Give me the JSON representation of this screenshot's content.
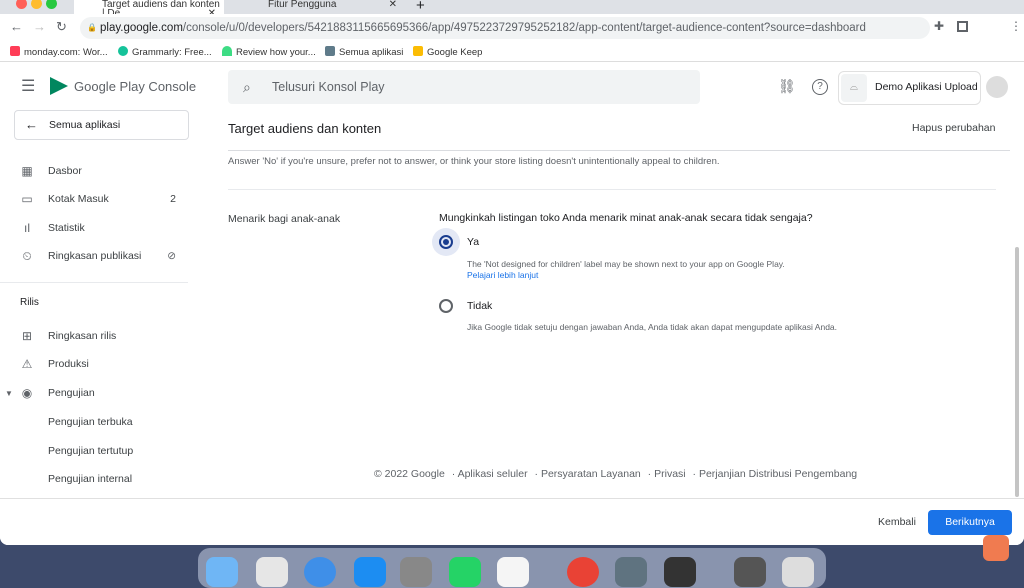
{
  "browser": {
    "tabs": [
      {
        "title": "Target audiens dan konten | De"
      },
      {
        "title": "Fitur Pengguna"
      }
    ],
    "url_host": "play.google.com",
    "url_path": "/console/u/0/developers/5421883115665695366/app/4975223729795252182/app-content/target-audience-content?source=dashboard",
    "bookmarks": [
      {
        "label": "monday.com: Wor...",
        "color": "#ff3d57"
      },
      {
        "label": "Grammarly: Free...",
        "color": "#15c39a"
      },
      {
        "label": "Review how your...",
        "color": "#3ddc84"
      },
      {
        "label": "Semua aplikasi",
        "color": "#5f7b8a"
      },
      {
        "label": "Google Keep",
        "color": "#fbbc04"
      }
    ]
  },
  "header": {
    "logo": "Google Play Console",
    "search_placeholder": "Telusuri Konsol Play",
    "app_name": "Demo Aplikasi Upload"
  },
  "sidebar": {
    "all_apps": "Semua aplikasi",
    "items": [
      {
        "label": "Dasbor",
        "icon": "dashboard-icon"
      },
      {
        "label": "Kotak Masuk",
        "badge": "2",
        "icon": "inbox-icon"
      },
      {
        "label": "Statistik",
        "icon": "bar-chart-icon"
      },
      {
        "label": "Ringkasan publikasi",
        "icon": "publishing-icon"
      }
    ],
    "section": "Rilis",
    "release_items": [
      {
        "label": "Ringkasan rilis"
      },
      {
        "label": "Produksi"
      },
      {
        "label": "Pengujian"
      }
    ],
    "testing_items": [
      "Pengujian terbuka",
      "Pengujian tertutup",
      "Pengujian internal"
    ]
  },
  "page": {
    "title": "Target audiens dan konten",
    "discard": "Hapus perubahan",
    "note": "Answer 'No' if you're unsure, prefer not to answer, or think your store listing doesn't unintentionally appeal to children.",
    "field_label": "Menarik bagi anak-anak",
    "question": "Mungkinkah listingan toko Anda menarik minat anak-anak secara tidak sengaja?",
    "options": [
      {
        "label": "Ya",
        "selected": true,
        "desc": "The 'Not designed for children' label may be shown next to your app on Google Play.",
        "link": "Pelajari lebih lanjut"
      },
      {
        "label": "Tidak",
        "selected": false,
        "desc": "Jika Google tidak setuju dengan jawaban Anda, Anda tidak akan dapat mengupdate aplikasi Anda."
      }
    ]
  },
  "footer": [
    "© 2022 Google",
    "Aplikasi seluler",
    "Persyaratan Layanan",
    "Privasi",
    "Perjanjian Distribusi Pengembang"
  ],
  "actions": {
    "back": "Kembali",
    "next": "Berikutnya"
  },
  "colors": {
    "accent": "#1a73e8",
    "selected_radio": "#1a3d8f"
  }
}
